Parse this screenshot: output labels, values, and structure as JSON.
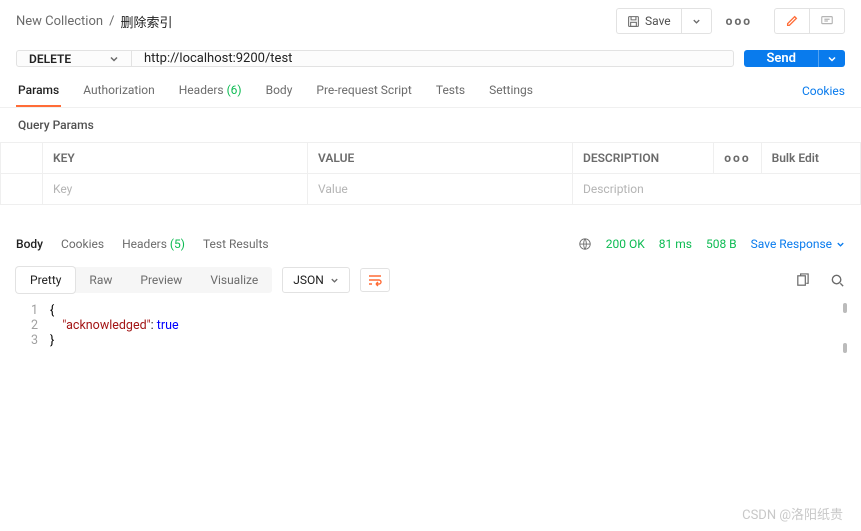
{
  "breadcrumb": {
    "collection": "New Collection",
    "sep": "/",
    "current": "删除索引"
  },
  "topbar": {
    "save": "Save"
  },
  "request": {
    "method": "DELETE",
    "url": "http://localhost:9200/test",
    "send": "Send"
  },
  "reqTabs": {
    "params": "Params",
    "auth": "Authorization",
    "headers": "Headers",
    "headers_count": "(6)",
    "body": "Body",
    "prereq": "Pre-request Script",
    "tests": "Tests",
    "settings": "Settings",
    "cookies": "Cookies"
  },
  "queryParams": {
    "title": "Query Params",
    "cols": {
      "key": "KEY",
      "value": "VALUE",
      "desc": "DESCRIPTION",
      "bulk": "Bulk Edit"
    },
    "placeholders": {
      "key": "Key",
      "value": "Value",
      "desc": "Description"
    }
  },
  "respTabs": {
    "body": "Body",
    "cookies": "Cookies",
    "headers": "Headers",
    "headers_count": "(5)",
    "results": "Test Results"
  },
  "respMeta": {
    "status": "200 OK",
    "time": "81 ms",
    "size": "508 B",
    "save": "Save Response"
  },
  "viewModes": {
    "pretty": "Pretty",
    "raw": "Raw",
    "preview": "Preview",
    "visualize": "Visualize",
    "format": "JSON"
  },
  "responseBody": {
    "l1": "{",
    "l2_key": "\"acknowledged\"",
    "l2_sep": ": ",
    "l2_val": "true",
    "l3": "}"
  },
  "lineNums": {
    "n1": "1",
    "n2": "2",
    "n3": "3"
  },
  "watermark": "CSDN @洛阳纸贵"
}
